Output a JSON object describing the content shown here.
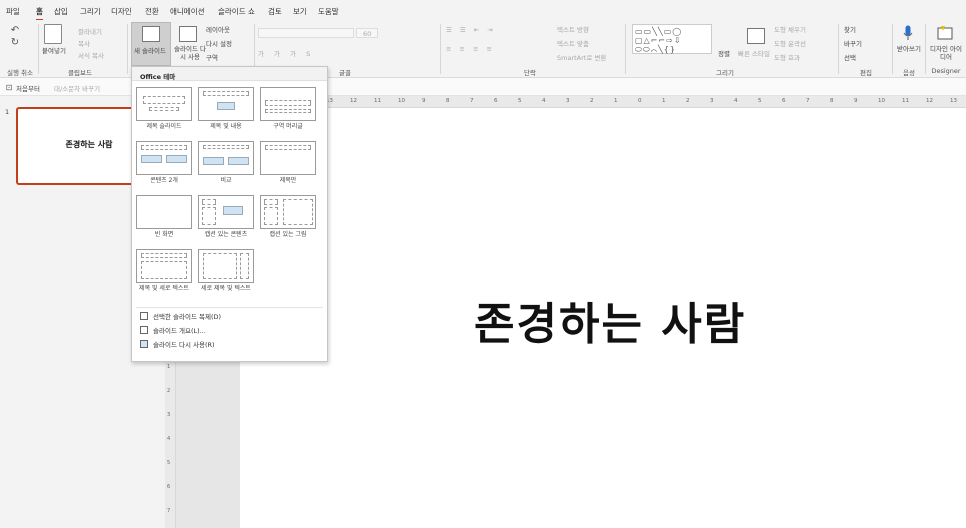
{
  "tabs": [
    "파일",
    "홈",
    "삽입",
    "그리기",
    "디자인",
    "전환",
    "애니메이션",
    "슬라이드 쇼",
    "검토",
    "보기",
    "도움말"
  ],
  "active_tab": "홈",
  "ribbon": {
    "undo": {
      "group_label": "실행 취소"
    },
    "clipboard": {
      "paste": "붙여넣기",
      "cut": "잘라내기",
      "copy": "복사",
      "format_painter": "서식 복사",
      "group_label": "클립보드"
    },
    "slides": {
      "new_slide": "새 슬라이드",
      "reuse": "슬라이드 다시 사용",
      "layout": "레이아웃",
      "reset": "다시 설정",
      "section": "구역"
    },
    "font": {
      "size": "60",
      "group_label": "글꼴"
    },
    "paragraph": {
      "text_direction": "텍스트 방향",
      "align_text": "텍스트 맞춤",
      "smartart": "SmartArt로 변환",
      "group_label": "단락"
    },
    "drawing": {
      "arrange": "정렬",
      "quick_styles": "빠른 스타일",
      "fill": "도형 채우기",
      "outline": "도형 윤곽선",
      "effects": "도형 효과",
      "group_label": "그리기"
    },
    "editing": {
      "find": "찾기",
      "replace": "바꾸기",
      "select": "선택",
      "group_label": "편집"
    },
    "voice": {
      "dictate": "받아쓰기",
      "group_label": "음성"
    },
    "designer": {
      "design_ideas": "디자인 아이디어",
      "group_label": "Designer"
    }
  },
  "quickbar": {
    "from_beginning": "처음부터",
    "change_case": "대/소문자 바꾸기"
  },
  "ruler_labels": [
    "13",
    "12",
    "11",
    "10",
    "9",
    "8",
    "7",
    "6",
    "5",
    "4",
    "3",
    "2",
    "1",
    "0",
    "1",
    "2",
    "3",
    "4",
    "5",
    "6",
    "7",
    "8",
    "9",
    "10",
    "11",
    "12",
    "13",
    "14"
  ],
  "vruler_labels": [
    "1",
    "2",
    "3",
    "4",
    "5",
    "6",
    "7",
    "8"
  ],
  "thumbnail": {
    "number": "1",
    "title": "존경하는 사람"
  },
  "slide": {
    "title": "존경하는 사람"
  },
  "dropdown": {
    "header": "Office 테마",
    "layouts": [
      "제목 슬라이드",
      "제목 및 내용",
      "구역 머리글",
      "콘텐츠 2개",
      "비교",
      "제목만",
      "빈 화면",
      "캡션 있는 콘텐츠",
      "캡션 있는 그림",
      "제목 및 세로 텍스트",
      "세로 제목 및 텍스트"
    ],
    "menu": [
      "선택한 슬라이드 복제(D)",
      "슬라이드 개요(L)...",
      "슬라이드 다시 사용(R)"
    ]
  },
  "colors": {
    "accent": "#c43e1c",
    "ribbon_bg": "#f3f3f3"
  }
}
